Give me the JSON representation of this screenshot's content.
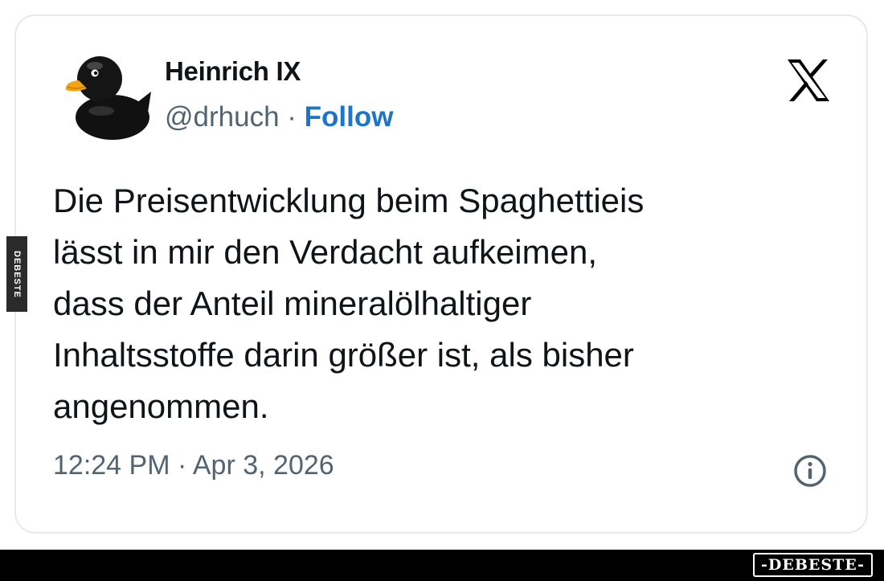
{
  "tweet": {
    "author": {
      "display_name": "Heinrich IX",
      "handle": "@drhuch",
      "separator": " · ",
      "follow_label": "Follow",
      "avatar_icon": "rubber-duck-avatar"
    },
    "platform_icon": "x-logo",
    "text_lines": [
      "Die Preisentwicklung beim Spaghettieis",
      "lässt in mir den Verdacht aufkeimen,",
      "dass der Anteil mineralölhaltiger",
      "Inhaltsstoffe darin größer ist, als bisher",
      "angenommen."
    ],
    "time": "12:24 PM",
    "date_separator": " · ",
    "date": "Apr 3, 2026",
    "info_icon": "info-icon"
  },
  "watermarks": {
    "side_text": "DEBESTE",
    "logo_text": "-DEBESTE-"
  },
  "colors": {
    "text_primary": "#0f1419",
    "text_secondary": "#536471",
    "link_blue": "#1d74c9",
    "card_border": "#e7e9ea",
    "bottom_bar": "#000000"
  }
}
